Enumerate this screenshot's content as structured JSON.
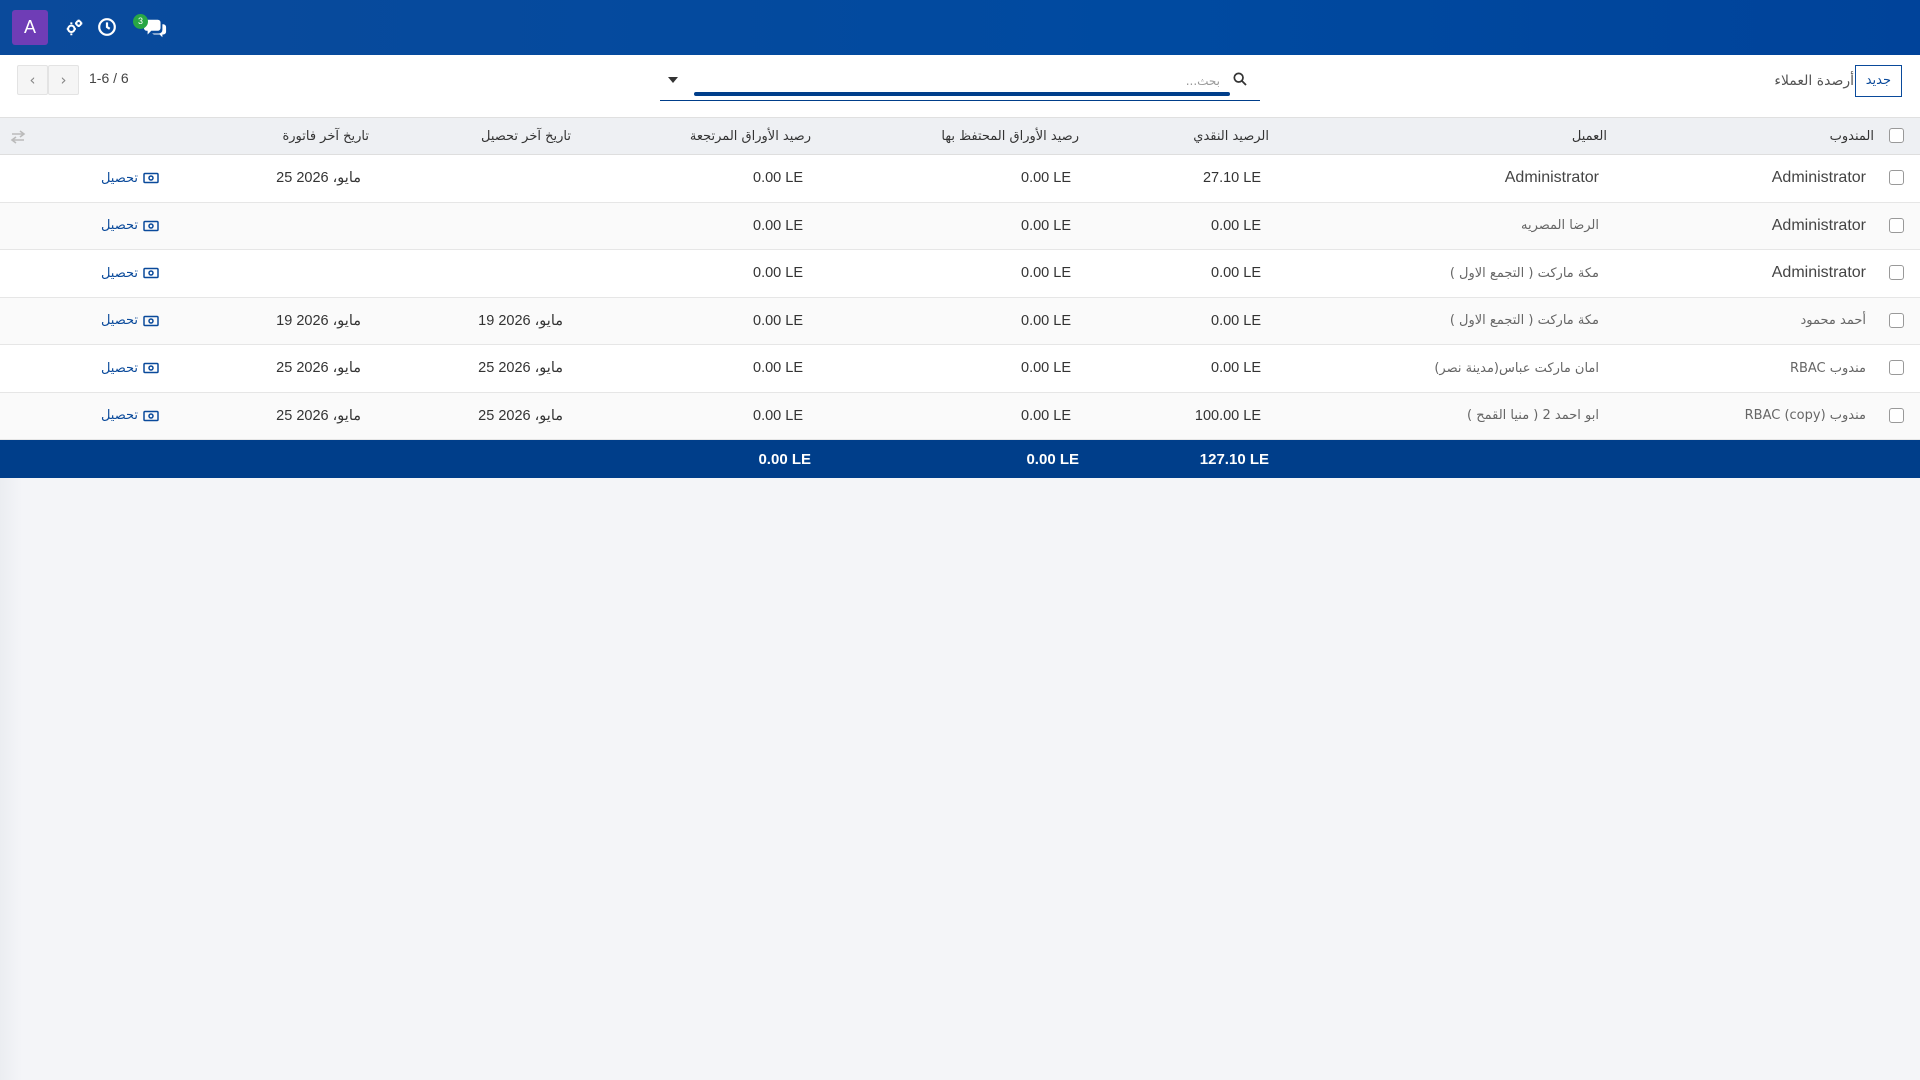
{
  "app": {
    "avatar_letter": "A",
    "chat_badge": "3",
    "accent_color": "#0a4a9b",
    "footer_color": "#003e8a",
    "icons": [
      "tools-icon",
      "clock-icon",
      "chat-icon"
    ]
  },
  "control": {
    "breadcrumb": "أرصدة العملاء",
    "new_label": "جديد",
    "search_placeholder": "بحث...",
    "pager": "1-6 / 6"
  },
  "table": {
    "headers": {
      "rep": "المندوب",
      "customer": "العميل",
      "cash_balance": "الرصيد النقدي",
      "held_papers": "رصيد الأوراق المحتفظ بها",
      "returned_papers": "رصيد الأوراق المرتجعة",
      "last_collection": "تاريخ آخر تحصيل",
      "last_invoice": "تاريخ آخر فاتورة"
    },
    "rows": [
      {
        "rep": "Administrator",
        "customer": "Administrator",
        "cash": "27.10 LE",
        "held": "0.00 LE",
        "returned": "0.00 LE",
        "last_collection": "",
        "last_invoice": "25 مايو، 2026",
        "action": "تحصيل"
      },
      {
        "rep": "Administrator",
        "customer": "الرضا المصريه",
        "cash": "0.00 LE",
        "held": "0.00 LE",
        "returned": "0.00 LE",
        "last_collection": "",
        "last_invoice": "",
        "action": "تحصيل"
      },
      {
        "rep": "Administrator",
        "customer": "مكة ماركت ( التجمع الاول )",
        "cash": "0.00 LE",
        "held": "0.00 LE",
        "returned": "0.00 LE",
        "last_collection": "",
        "last_invoice": "",
        "action": "تحصيل"
      },
      {
        "rep": "أحمد محمود",
        "customer": "مكة ماركت ( التجمع الاول )",
        "cash": "0.00 LE",
        "held": "0.00 LE",
        "returned": "0.00 LE",
        "last_collection": "19 مايو، 2026",
        "last_invoice": "19 مايو، 2026",
        "action": "تحصيل"
      },
      {
        "rep": "مندوب RBAC",
        "customer": "امان ماركت عباس(مدينة نصر)",
        "cash": "0.00 LE",
        "held": "0.00 LE",
        "returned": "0.00 LE",
        "last_collection": "25 مايو، 2026",
        "last_invoice": "25 مايو، 2026",
        "action": "تحصيل"
      },
      {
        "rep": "مندوب RBAC (copy)",
        "customer": "ابو احمد 2 ( منيا القمح )",
        "cash": "100.00 LE",
        "held": "0.00 LE",
        "returned": "0.00 LE",
        "last_collection": "25 مايو، 2026",
        "last_invoice": "25 مايو، 2026",
        "action": "تحصيل"
      }
    ],
    "totals": {
      "cash": "127.10 LE",
      "held": "0.00 LE",
      "returned": "0.00 LE"
    }
  }
}
